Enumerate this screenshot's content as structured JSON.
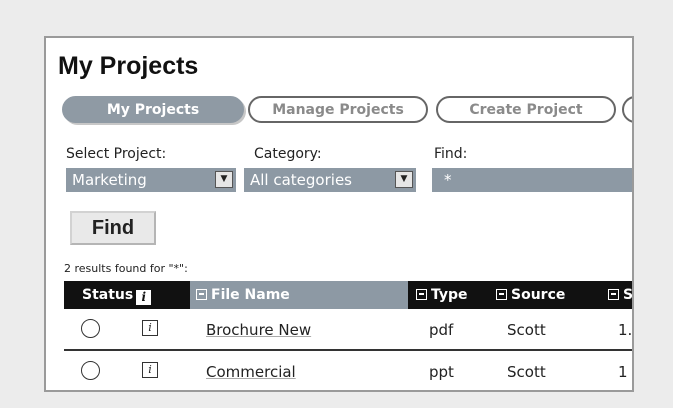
{
  "page_title": "My Projects",
  "tabs": [
    {
      "label": "My Projects",
      "active": true
    },
    {
      "label": "Manage Projects",
      "active": false
    },
    {
      "label": "Create Project",
      "active": false
    },
    {
      "label": "",
      "active": false
    }
  ],
  "filters": {
    "select_project": {
      "label": "Select Project:",
      "value": "Marketing"
    },
    "category": {
      "label": "Category:",
      "value": "All categories"
    },
    "find": {
      "label": "Find:",
      "value": "*"
    }
  },
  "find_button_label": "Find",
  "results_text": "2 results found for \"*\":",
  "table": {
    "columns": {
      "status": "Status",
      "file_name": "File Name",
      "type": "Type",
      "source": "Source",
      "size": "S"
    },
    "rows": [
      {
        "file_name": "Brochure New",
        "type": "pdf",
        "source": "Scott",
        "size": "1."
      },
      {
        "file_name": "Commercial",
        "type": "ppt",
        "source": "Scott",
        "size": "1"
      }
    ]
  },
  "colors": {
    "accent_gray": "#8d99a4",
    "header_black": "#111111",
    "background": "#ececec"
  }
}
